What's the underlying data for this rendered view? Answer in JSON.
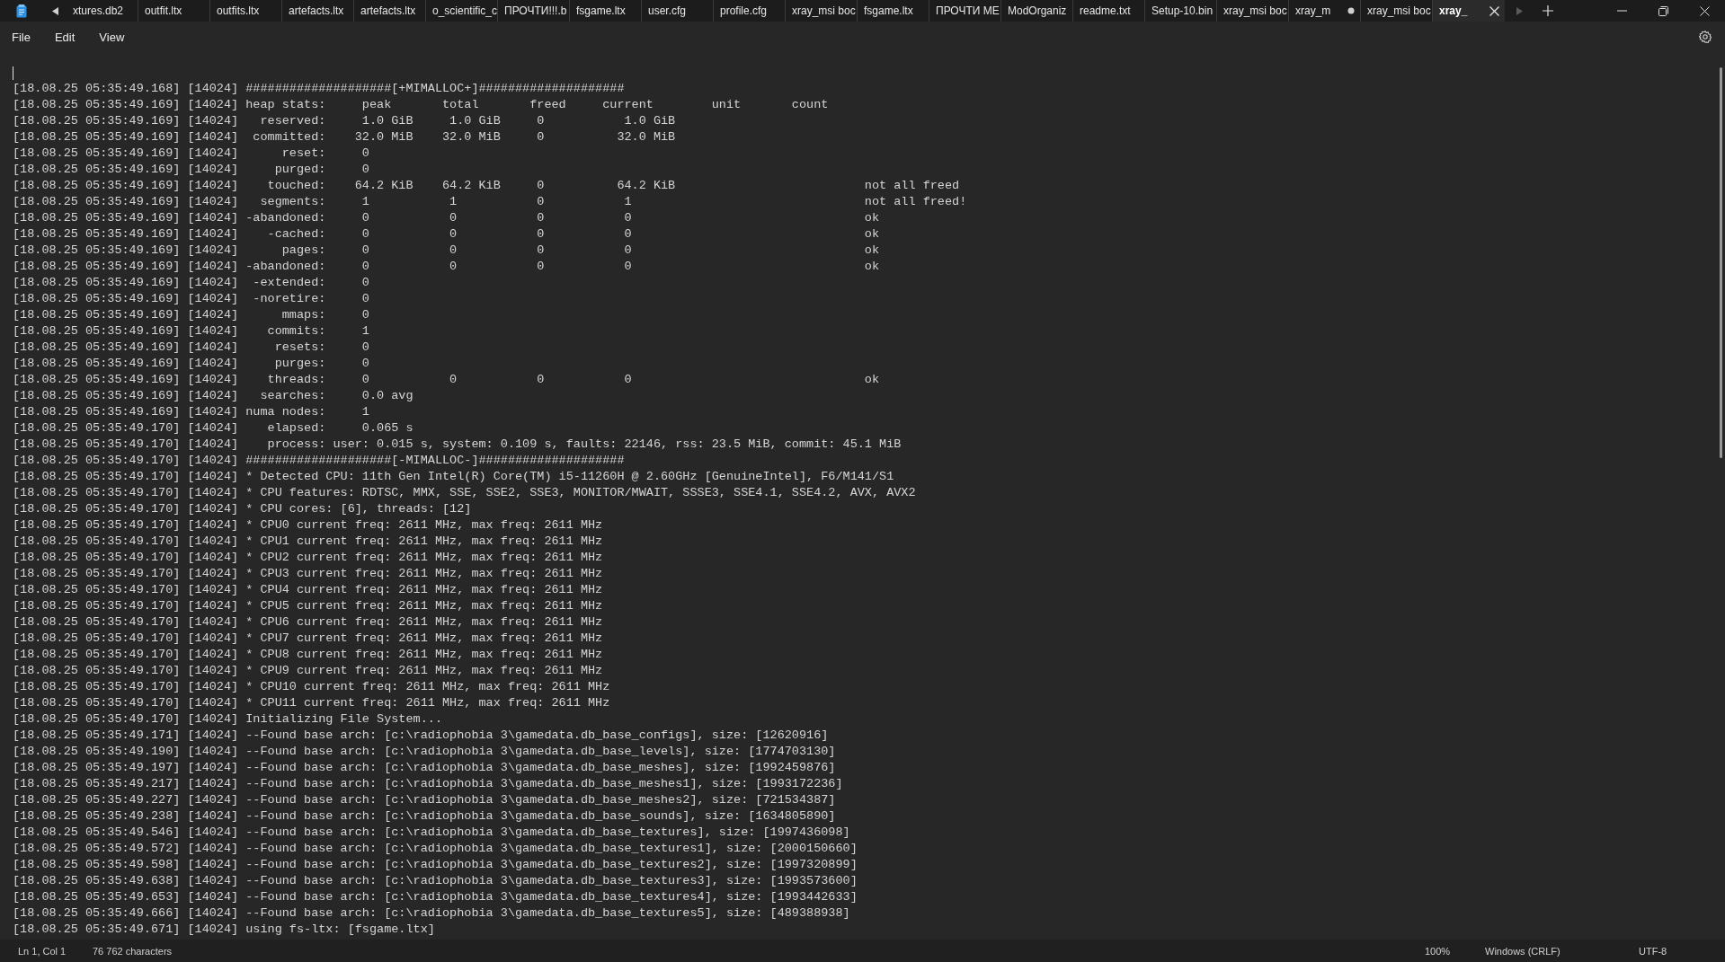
{
  "tabs": [
    {
      "label": "xtures.db2",
      "selected": false,
      "modified": false
    },
    {
      "label": "outfit.ltx",
      "selected": false,
      "modified": false
    },
    {
      "label": "outfits.ltx",
      "selected": false,
      "modified": false
    },
    {
      "label": "artefacts.ltx",
      "selected": false,
      "modified": false
    },
    {
      "label": "artefacts.ltx",
      "selected": false,
      "modified": false
    },
    {
      "label": "o_scientific_c",
      "selected": false,
      "modified": false
    },
    {
      "label": "ПРОЧТИ!!!.b",
      "selected": false,
      "modified": false
    },
    {
      "label": "fsgame.ltx",
      "selected": false,
      "modified": false
    },
    {
      "label": "user.cfg",
      "selected": false,
      "modified": false
    },
    {
      "label": "profile.cfg",
      "selected": false,
      "modified": false
    },
    {
      "label": "xray_msi boc",
      "selected": false,
      "modified": false
    },
    {
      "label": "fsgame.ltx",
      "selected": false,
      "modified": false
    },
    {
      "label": "ПРОЧТИ МЕ",
      "selected": false,
      "modified": false
    },
    {
      "label": "ModOrganiz",
      "selected": false,
      "modified": false
    },
    {
      "label": "readme.txt",
      "selected": false,
      "modified": false
    },
    {
      "label": "Setup-10.bin",
      "selected": false,
      "modified": false
    },
    {
      "label": "xray_msi boc",
      "selected": false,
      "modified": false
    },
    {
      "label": "xray_m",
      "selected": false,
      "modified": true
    },
    {
      "label": "xray_msi boc",
      "selected": false,
      "modified": false
    },
    {
      "label": "xray_",
      "selected": true,
      "modified": false
    }
  ],
  "menu": [
    "File",
    "Edit",
    "View"
  ],
  "editor": {
    "lines": [
      "[18.08.25 05:35:49.168] [14024] ####################[+MIMALLOC+]####################",
      "[18.08.25 05:35:49.169] [14024] heap stats:     peak       total       freed     current        unit       count",
      "[18.08.25 05:35:49.169] [14024]   reserved:     1.0 GiB     1.0 GiB     0           1.0 GiB",
      "[18.08.25 05:35:49.169] [14024]  committed:    32.0 MiB    32.0 MiB     0          32.0 MiB",
      "[18.08.25 05:35:49.169] [14024]      reset:     0",
      "[18.08.25 05:35:49.169] [14024]     purged:     0",
      "[18.08.25 05:35:49.169] [14024]    touched:    64.2 KiB    64.2 KiB     0          64.2 KiB                          not all freed",
      "[18.08.25 05:35:49.169] [14024]   segments:     1           1           0           1                                not all freed!",
      "[18.08.25 05:35:49.169] [14024] -abandoned:     0           0           0           0                                ok",
      "[18.08.25 05:35:49.169] [14024]    -cached:     0           0           0           0                                ok",
      "[18.08.25 05:35:49.169] [14024]      pages:     0           0           0           0                                ok",
      "[18.08.25 05:35:49.169] [14024] -abandoned:     0           0           0           0                                ok",
      "[18.08.25 05:35:49.169] [14024]  -extended:     0",
      "[18.08.25 05:35:49.169] [14024]  -noretire:     0",
      "[18.08.25 05:35:49.169] [14024]      mmaps:     0",
      "[18.08.25 05:35:49.169] [14024]    commits:     1",
      "[18.08.25 05:35:49.169] [14024]     resets:     0",
      "[18.08.25 05:35:49.169] [14024]     purges:     0",
      "[18.08.25 05:35:49.169] [14024]    threads:     0           0           0           0                                ok",
      "[18.08.25 05:35:49.169] [14024]   searches:     0.0 avg",
      "[18.08.25 05:35:49.169] [14024] numa nodes:     1",
      "[18.08.25 05:35:49.170] [14024]    elapsed:     0.065 s",
      "[18.08.25 05:35:49.170] [14024]    process: user: 0.015 s, system: 0.109 s, faults: 22146, rss: 23.5 MiB, commit: 45.1 MiB",
      "[18.08.25 05:35:49.170] [14024] ####################[-MIMALLOC-]####################",
      "[18.08.25 05:35:49.170] [14024] * Detected CPU: 11th Gen Intel(R) Core(TM) i5-11260H @ 2.60GHz [GenuineIntel], F6/M141/S1",
      "[18.08.25 05:35:49.170] [14024] * CPU features: RDTSC, MMX, SSE, SSE2, SSE3, MONITOR/MWAIT, SSSE3, SSE4.1, SSE4.2, AVX, AVX2",
      "[18.08.25 05:35:49.170] [14024] * CPU cores: [6], threads: [12]",
      "[18.08.25 05:35:49.170] [14024] * CPU0 current freq: 2611 MHz, max freq: 2611 MHz",
      "[18.08.25 05:35:49.170] [14024] * CPU1 current freq: 2611 MHz, max freq: 2611 MHz",
      "[18.08.25 05:35:49.170] [14024] * CPU2 current freq: 2611 MHz, max freq: 2611 MHz",
      "[18.08.25 05:35:49.170] [14024] * CPU3 current freq: 2611 MHz, max freq: 2611 MHz",
      "[18.08.25 05:35:49.170] [14024] * CPU4 current freq: 2611 MHz, max freq: 2611 MHz",
      "[18.08.25 05:35:49.170] [14024] * CPU5 current freq: 2611 MHz, max freq: 2611 MHz",
      "[18.08.25 05:35:49.170] [14024] * CPU6 current freq: 2611 MHz, max freq: 2611 MHz",
      "[18.08.25 05:35:49.170] [14024] * CPU7 current freq: 2611 MHz, max freq: 2611 MHz",
      "[18.08.25 05:35:49.170] [14024] * CPU8 current freq: 2611 MHz, max freq: 2611 MHz",
      "[18.08.25 05:35:49.170] [14024] * CPU9 current freq: 2611 MHz, max freq: 2611 MHz",
      "[18.08.25 05:35:49.170] [14024] * CPU10 current freq: 2611 MHz, max freq: 2611 MHz",
      "[18.08.25 05:35:49.170] [14024] * CPU11 current freq: 2611 MHz, max freq: 2611 MHz",
      "[18.08.25 05:35:49.170] [14024] Initializing File System...",
      "[18.08.25 05:35:49.171] [14024] --Found base arch: [c:\\radiophobia 3\\gamedata.db_base_configs], size: [12620916]",
      "[18.08.25 05:35:49.190] [14024] --Found base arch: [c:\\radiophobia 3\\gamedata.db_base_levels], size: [1774703130]",
      "[18.08.25 05:35:49.197] [14024] --Found base arch: [c:\\radiophobia 3\\gamedata.db_base_meshes], size: [1992459876]",
      "[18.08.25 05:35:49.217] [14024] --Found base arch: [c:\\radiophobia 3\\gamedata.db_base_meshes1], size: [1993172236]",
      "[18.08.25 05:35:49.227] [14024] --Found base arch: [c:\\radiophobia 3\\gamedata.db_base_meshes2], size: [721534387]",
      "[18.08.25 05:35:49.238] [14024] --Found base arch: [c:\\radiophobia 3\\gamedata.db_base_sounds], size: [1634805890]",
      "[18.08.25 05:35:49.546] [14024] --Found base arch: [c:\\radiophobia 3\\gamedata.db_base_textures], size: [1997436098]",
      "[18.08.25 05:35:49.572] [14024] --Found base arch: [c:\\radiophobia 3\\gamedata.db_base_textures1], size: [2000150660]",
      "[18.08.25 05:35:49.598] [14024] --Found base arch: [c:\\radiophobia 3\\gamedata.db_base_textures2], size: [1997320899]",
      "[18.08.25 05:35:49.638] [14024] --Found base arch: [c:\\radiophobia 3\\gamedata.db_base_textures3], size: [1993573600]",
      "[18.08.25 05:35:49.653] [14024] --Found base arch: [c:\\radiophobia 3\\gamedata.db_base_textures4], size: [1993442633]",
      "[18.08.25 05:35:49.666] [14024] --Found base arch: [c:\\radiophobia 3\\gamedata.db_base_textures5], size: [489388938]",
      "[18.08.25 05:35:49.671] [14024] using fs-ltx: [fsgame.ltx]"
    ]
  },
  "status_bar": {
    "position": "Ln 1, Col 1",
    "characters": "76 762 characters",
    "zoom": "100%",
    "line_ending": "Windows (CRLF)",
    "encoding": "UTF-8"
  }
}
